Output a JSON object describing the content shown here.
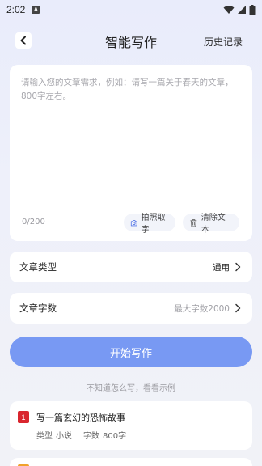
{
  "status": {
    "time": "2:02",
    "app_icon_letter": "A"
  },
  "header": {
    "title": "智能写作",
    "history_label": "历史记录"
  },
  "input": {
    "placeholder": "请输入您的文章需求，例如：请写一篇关于春天的文章，800字左右。",
    "char_count": "0/200",
    "photo_label": "拍照取字",
    "clear_label": "清除文本"
  },
  "article_type": {
    "label": "文章类型",
    "value": "通用"
  },
  "word_count": {
    "label": "文章字数",
    "value": "最大字数2000"
  },
  "start_button": {
    "label": "开始写作"
  },
  "hint": {
    "text": "不知道怎么写，看看示例"
  },
  "examples": [
    {
      "index": "1",
      "title": "写一篇玄幻的恐怖故事",
      "type_label": "类型",
      "type_value": "小说",
      "count_label": "字数",
      "count_value": "800字"
    }
  ],
  "colors": {
    "accent": "#7899f3",
    "badge_first": "#d9262e",
    "badge_second": "#f0a22b"
  }
}
